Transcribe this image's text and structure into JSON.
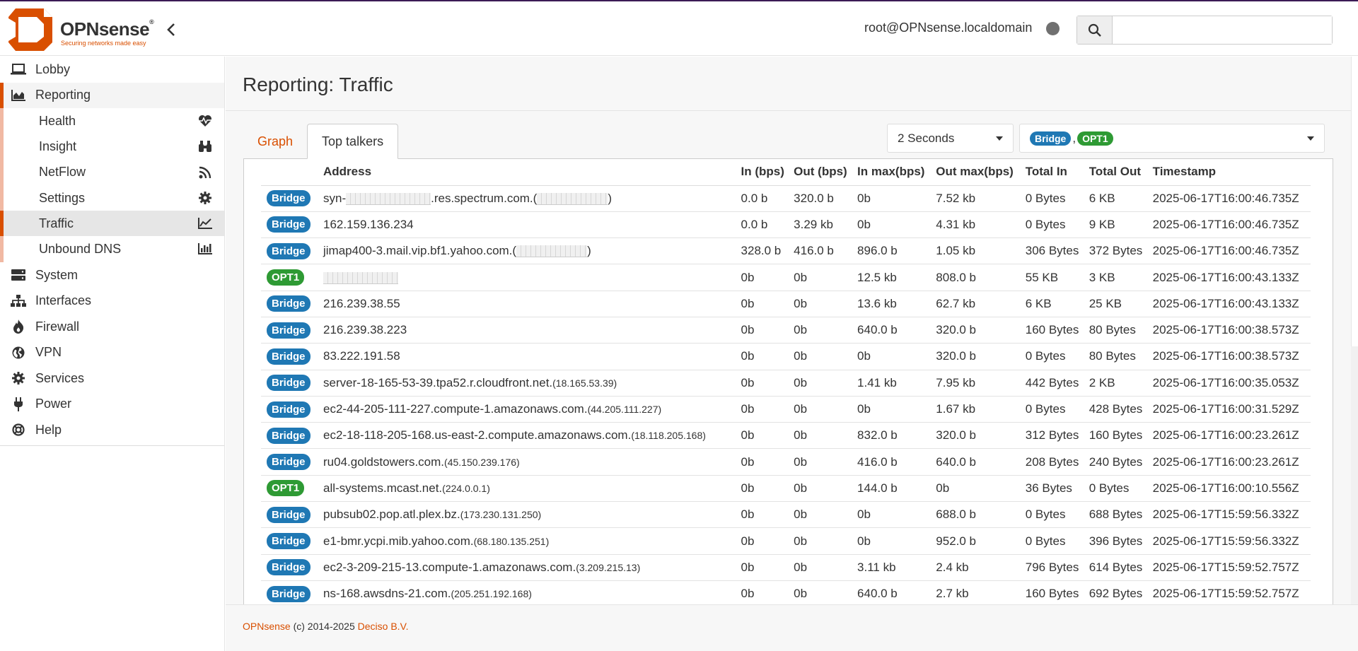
{
  "header": {
    "brand": "OPNsense",
    "brand_mark": "®",
    "tagline": "Securing networks made easy",
    "user": "root@OPNsense.localdomain",
    "search_placeholder": "",
    "search_value": ""
  },
  "sidebar": {
    "items": [
      {
        "label": "Lobby",
        "icon": "laptop-icon"
      },
      {
        "label": "Reporting",
        "icon": "area-chart-icon"
      },
      {
        "label": "System",
        "icon": "server-icon"
      },
      {
        "label": "Interfaces",
        "icon": "sitemap-icon"
      },
      {
        "label": "Firewall",
        "icon": "fire-icon"
      },
      {
        "label": "VPN",
        "icon": "globe-icon"
      },
      {
        "label": "Services",
        "icon": "cog-icon"
      },
      {
        "label": "Power",
        "icon": "plug-icon"
      },
      {
        "label": "Help",
        "icon": "life-ring-icon"
      }
    ],
    "reporting_sub": [
      {
        "label": "Health",
        "icon": "heartbeat-icon"
      },
      {
        "label": "Insight",
        "icon": "binoculars-icon"
      },
      {
        "label": "NetFlow",
        "icon": "rss-icon"
      },
      {
        "label": "Settings",
        "icon": "cog-icon"
      },
      {
        "label": "Traffic",
        "icon": "line-chart-icon"
      },
      {
        "label": "Unbound DNS",
        "icon": "bar-chart-icon"
      }
    ]
  },
  "page": {
    "title": "Reporting: Traffic",
    "tabs": [
      "Graph",
      "Top talkers"
    ],
    "active_tab": "Top talkers",
    "interval": "2 Seconds",
    "interfaces": [
      "Bridge",
      "OPT1"
    ],
    "interface_separator": ","
  },
  "table": {
    "columns": [
      "Address",
      "In (bps)",
      "Out (bps)",
      "In max(bps)",
      "Out max(bps)",
      "Total In",
      "Total Out",
      "Timestamp"
    ],
    "rows": [
      {
        "iface": "Bridge",
        "host_pre": "syn-",
        "host_post": ".res.spectrum.com.(",
        "host_tail": ")",
        "ip": "",
        "in": "0.0 b",
        "out": "320.0 b",
        "in_max": "0b",
        "out_max": "7.52 kb",
        "total_in": "0 Bytes",
        "total_out": "6 KB",
        "ts": "2025-06-17T16:00:46.735Z"
      },
      {
        "iface": "Bridge",
        "host": "162.159.136.234",
        "ip": "",
        "in": "0.0 b",
        "out": "3.29 kb",
        "in_max": "0b",
        "out_max": "4.31 kb",
        "total_in": "0 Bytes",
        "total_out": "9 KB",
        "ts": "2025-06-17T16:00:46.735Z"
      },
      {
        "iface": "Bridge",
        "host_pre": "jimap400-3.mail.vip.bf1.yahoo.com.(",
        "host_post": "",
        "host_tail": ")",
        "ip": "",
        "in": "328.0 b",
        "out": "416.0 b",
        "in_max": "896.0 b",
        "out_max": "1.05 kb",
        "total_in": "306 Bytes",
        "total_out": "372 Bytes",
        "ts": "2025-06-17T16:00:46.735Z"
      },
      {
        "iface": "OPT1",
        "host": "",
        "ip": "",
        "in": "0b",
        "out": "0b",
        "in_max": "12.5 kb",
        "out_max": "808.0 b",
        "total_in": "55 KB",
        "total_out": "3 KB",
        "ts": "2025-06-17T16:00:43.133Z"
      },
      {
        "iface": "Bridge",
        "host": "216.239.38.55",
        "ip": "",
        "in": "0b",
        "out": "0b",
        "in_max": "13.6 kb",
        "out_max": "62.7 kb",
        "total_in": "6 KB",
        "total_out": "25 KB",
        "ts": "2025-06-17T16:00:43.133Z"
      },
      {
        "iface": "Bridge",
        "host": "216.239.38.223",
        "ip": "",
        "in": "0b",
        "out": "0b",
        "in_max": "640.0 b",
        "out_max": "320.0 b",
        "total_in": "160 Bytes",
        "total_out": "80 Bytes",
        "ts": "2025-06-17T16:00:38.573Z"
      },
      {
        "iface": "Bridge",
        "host": "83.222.191.58",
        "ip": "",
        "in": "0b",
        "out": "0b",
        "in_max": "0b",
        "out_max": "320.0 b",
        "total_in": "0 Bytes",
        "total_out": "80 Bytes",
        "ts": "2025-06-17T16:00:38.573Z"
      },
      {
        "iface": "Bridge",
        "host": "server-18-165-53-39.tpa52.r.cloudfront.net.",
        "ip": "(18.165.53.39)",
        "in": "0b",
        "out": "0b",
        "in_max": "1.41 kb",
        "out_max": "7.95 kb",
        "total_in": "442 Bytes",
        "total_out": "2 KB",
        "ts": "2025-06-17T16:00:35.053Z"
      },
      {
        "iface": "Bridge",
        "host": "ec2-44-205-111-227.compute-1.amazonaws.com.",
        "ip": "(44.205.111.227)",
        "in": "0b",
        "out": "0b",
        "in_max": "0b",
        "out_max": "1.67 kb",
        "total_in": "0 Bytes",
        "total_out": "428 Bytes",
        "ts": "2025-06-17T16:00:31.529Z"
      },
      {
        "iface": "Bridge",
        "host": "ec2-18-118-205-168.us-east-2.compute.amazonaws.com.",
        "ip": "(18.118.205.168)",
        "in": "0b",
        "out": "0b",
        "in_max": "832.0 b",
        "out_max": "320.0 b",
        "total_in": "312 Bytes",
        "total_out": "160 Bytes",
        "ts": "2025-06-17T16:00:23.261Z"
      },
      {
        "iface": "Bridge",
        "host": "ru04.goldstowers.com.",
        "ip": "(45.150.239.176)",
        "in": "0b",
        "out": "0b",
        "in_max": "416.0 b",
        "out_max": "640.0 b",
        "total_in": "208 Bytes",
        "total_out": "240 Bytes",
        "ts": "2025-06-17T16:00:23.261Z"
      },
      {
        "iface": "OPT1",
        "host": "all-systems.mcast.net.",
        "ip": "(224.0.0.1)",
        "in": "0b",
        "out": "0b",
        "in_max": "144.0 b",
        "out_max": "0b",
        "total_in": "36 Bytes",
        "total_out": "0 Bytes",
        "ts": "2025-06-17T16:00:10.556Z"
      },
      {
        "iface": "Bridge",
        "host": "pubsub02.pop.atl.plex.bz.",
        "ip": "(173.230.131.250)",
        "in": "0b",
        "out": "0b",
        "in_max": "0b",
        "out_max": "688.0 b",
        "total_in": "0 Bytes",
        "total_out": "688 Bytes",
        "ts": "2025-06-17T15:59:56.332Z"
      },
      {
        "iface": "Bridge",
        "host": "e1-bmr.ycpi.mib.yahoo.com.",
        "ip": "(68.180.135.251)",
        "in": "0b",
        "out": "0b",
        "in_max": "0b",
        "out_max": "952.0 b",
        "total_in": "0 Bytes",
        "total_out": "396 Bytes",
        "ts": "2025-06-17T15:59:56.332Z"
      },
      {
        "iface": "Bridge",
        "host": "ec2-3-209-215-13.compute-1.amazonaws.com.",
        "ip": "(3.209.215.13)",
        "in": "0b",
        "out": "0b",
        "in_max": "3.11 kb",
        "out_max": "2.4 kb",
        "total_in": "796 Bytes",
        "total_out": "614 Bytes",
        "ts": "2025-06-17T15:59:52.757Z"
      },
      {
        "iface": "Bridge",
        "host": "ns-168.awsdns-21.com.",
        "ip": "(205.251.192.168)",
        "in": "0b",
        "out": "0b",
        "in_max": "640.0 b",
        "out_max": "2.7 kb",
        "total_in": "160 Bytes",
        "total_out": "692 Bytes",
        "ts": "2025-06-17T15:59:52.757Z"
      }
    ]
  },
  "footer": {
    "brand_link": "OPNsense",
    "copyright": " (c) 2014-2025 ",
    "company_link": "Deciso B.V."
  },
  "colors": {
    "accent": "#d94f00",
    "bridge": "#1f78b4",
    "opt1": "#2e9a34"
  }
}
